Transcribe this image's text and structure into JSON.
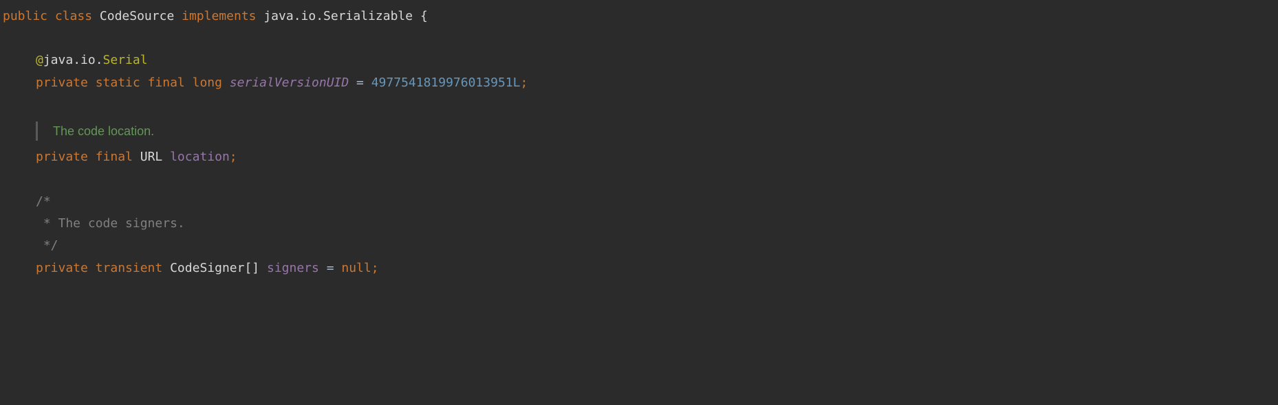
{
  "code": {
    "line1": {
      "public": "public",
      "class": "class",
      "className": "CodeSource",
      "implements": "implements",
      "interfacePkg": "java.io.Serializable",
      "brace": "{"
    },
    "line3": {
      "at": "@",
      "pkg": "java.io.",
      "name": "Serial"
    },
    "line4": {
      "private": "private",
      "static": "static",
      "final": "final",
      "long": "long",
      "field": "serialVersionUID",
      "eq": " = ",
      "value": "4977541819976013951L",
      "semi": ";"
    },
    "doc1": "The code location.",
    "line7": {
      "private": "private",
      "final": "final",
      "type": "URL",
      "field": "location",
      "semi": ";"
    },
    "comment": {
      "open": "/*",
      "body": " * The code signers.",
      "close": " */"
    },
    "line12": {
      "private": "private",
      "transient": "transient",
      "type": "CodeSigner",
      "brackets": "[]",
      "field": "signers",
      "eq": " = ",
      "null": "null",
      "semi": ";"
    }
  }
}
